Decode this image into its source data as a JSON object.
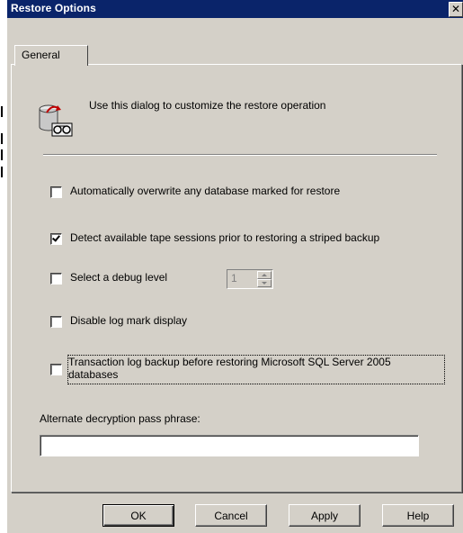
{
  "window": {
    "title": "Restore Options",
    "close_glyph": "✕"
  },
  "tabs": [
    {
      "label": "General",
      "active": true
    }
  ],
  "intro": {
    "icon": "database-restore-icon",
    "text": "Use this dialog to customize the restore operation"
  },
  "options": [
    {
      "label": "Automatically overwrite any database marked for restore",
      "checked": false
    },
    {
      "label": "Detect available tape sessions prior to restoring a striped backup",
      "checked": true
    },
    {
      "label": "Select a debug level",
      "checked": false
    },
    {
      "label": "Disable log mark display",
      "checked": false
    },
    {
      "label_line1": "Transaction log backup before restoring Microsoft SQL Server 2005",
      "label_line2": "databases",
      "checked": false
    }
  ],
  "debug_level": {
    "value": "1"
  },
  "passphrase": {
    "label": "Alternate decryption pass phrase:",
    "value": ""
  },
  "buttons": {
    "ok": "OK",
    "cancel": "Cancel",
    "apply": "Apply",
    "help": "Help"
  }
}
